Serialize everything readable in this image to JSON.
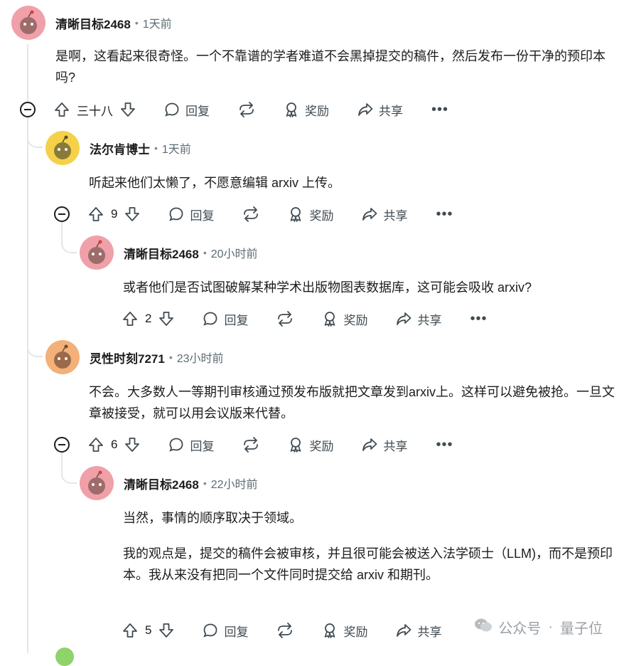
{
  "colors": {
    "avatar_pink": "#f0a0a8",
    "avatar_yellow": "#f5d14a",
    "avatar_orange": "#f3b079",
    "thread_line": "#e4e6e8",
    "watermark": "#9aa0a6"
  },
  "comments": [
    {
      "username": "清晰目标2468",
      "time": "1天前",
      "avatar_icon": "snoo-avatar-icon",
      "body": [
        "是啊，这看起来很奇怪。一个不靠谱的学者难道不会黑掉提交的稿件，然后发布一份干净的预印本吗?"
      ],
      "votes": "三十八"
    },
    {
      "username": "法尔肯博士",
      "time": "1天前",
      "avatar_icon": "snoo-avatar-icon",
      "body": [
        "听起来他们太懒了，不愿意编辑 arxiv 上传。"
      ],
      "votes": "9"
    },
    {
      "username": "清晰目标2468",
      "time": "20小时前",
      "avatar_icon": "snoo-avatar-icon",
      "body": [
        "或者他们是否试图破解某种学术出版物图表数据库，这可能会吸收 arxiv?"
      ],
      "votes": "2"
    },
    {
      "username": "灵性时刻7271",
      "time": "23小时前",
      "avatar_icon": "snoo-avatar-icon",
      "body": [
        "不会。大多数人一等期刊审核通过预发布版就把文章发到arxiv上。这样可以避免被抢。一旦文章被接受，就可以用会议版来代替。"
      ],
      "votes": "6"
    },
    {
      "username": "清晰目标2468",
      "time": "22小时前",
      "avatar_icon": "snoo-avatar-icon",
      "body": [
        "当然，事情的顺序取决于领域。",
        "我的观点是，提交的稿件会被审核，并且很可能会被送入法学硕士（LLM)，而不是预印本。我从来没有把同一个文件同时提交给 arxiv 和期刊。"
      ],
      "votes": "5"
    }
  ],
  "actions": {
    "reply": "回复",
    "award": "奖励",
    "share": "共享",
    "more": "•••",
    "meta_dot": "•"
  },
  "icons": {
    "upvote": "arrow-up-outline-icon",
    "downvote": "arrow-down-outline-icon",
    "reply": "speech-bubble-icon",
    "crosspost": "crosspost-icon",
    "award": "award-ribbon-icon",
    "share": "share-arrow-icon",
    "collapse": "collapse-minus-icon"
  },
  "watermark": {
    "brand": "公众号",
    "separator": "·",
    "name": "量子位"
  }
}
